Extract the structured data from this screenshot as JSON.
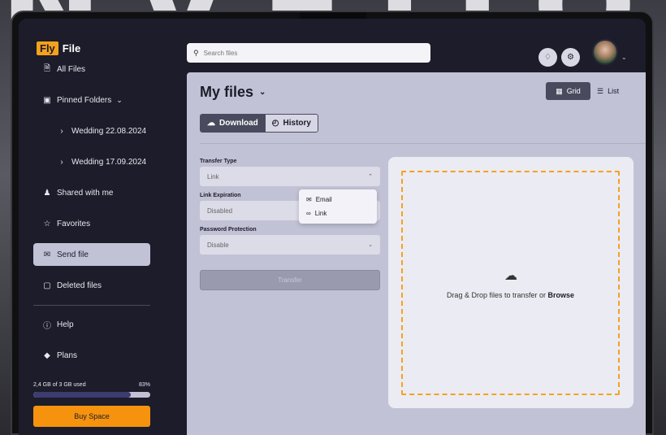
{
  "app": {
    "logo_fly": "Fly",
    "logo_file": "File"
  },
  "sidebar": {
    "items": [
      {
        "label": "All Files",
        "icon": "file-icon"
      },
      {
        "label": "Pinned Folders",
        "icon": "folder-icon",
        "chevron": "⌄"
      },
      {
        "label": "Wedding 22.08.2024",
        "icon": "chevron-right-icon"
      },
      {
        "label": "Wedding 17.09.2024",
        "icon": "chevron-right-icon"
      },
      {
        "label": "Shared with me",
        "icon": "users-icon"
      },
      {
        "label": "Favorites",
        "icon": "star-icon"
      },
      {
        "label": "Send file",
        "icon": "send-icon"
      },
      {
        "label": "Deleted files",
        "icon": "trash-icon"
      },
      {
        "label": "Help",
        "icon": "help-icon"
      },
      {
        "label": "Plans",
        "icon": "diamond-icon"
      }
    ],
    "storage": {
      "used_text": "2,4 GB of 3 GB used",
      "percent_text": "83%",
      "fraction": 0.83
    },
    "buy_label": "Buy Space"
  },
  "topbar": {
    "search_placeholder": "Search files"
  },
  "main": {
    "title": "My files",
    "view_grid": "Grid",
    "view_list": "List",
    "tabs": [
      "Download",
      "History"
    ],
    "transfer_type_label": "Transfer Type",
    "transfer_type_value": "Link",
    "link_expiration_label": "Link Expiration",
    "link_expiration_value": "Disabled",
    "password_label": "Password Protection",
    "password_value": "Disable",
    "transfer_button": "Transfer",
    "dropdown_options": [
      "Email",
      "Link"
    ],
    "drop_text": "Drag & Drop files to transfer",
    "drop_or": "or",
    "drop_browse": "Browse"
  },
  "colors": {
    "accent": "#f5a21b",
    "sidebar_bg": "#1c1c2a",
    "panel_bg": "#c2c2d6"
  }
}
